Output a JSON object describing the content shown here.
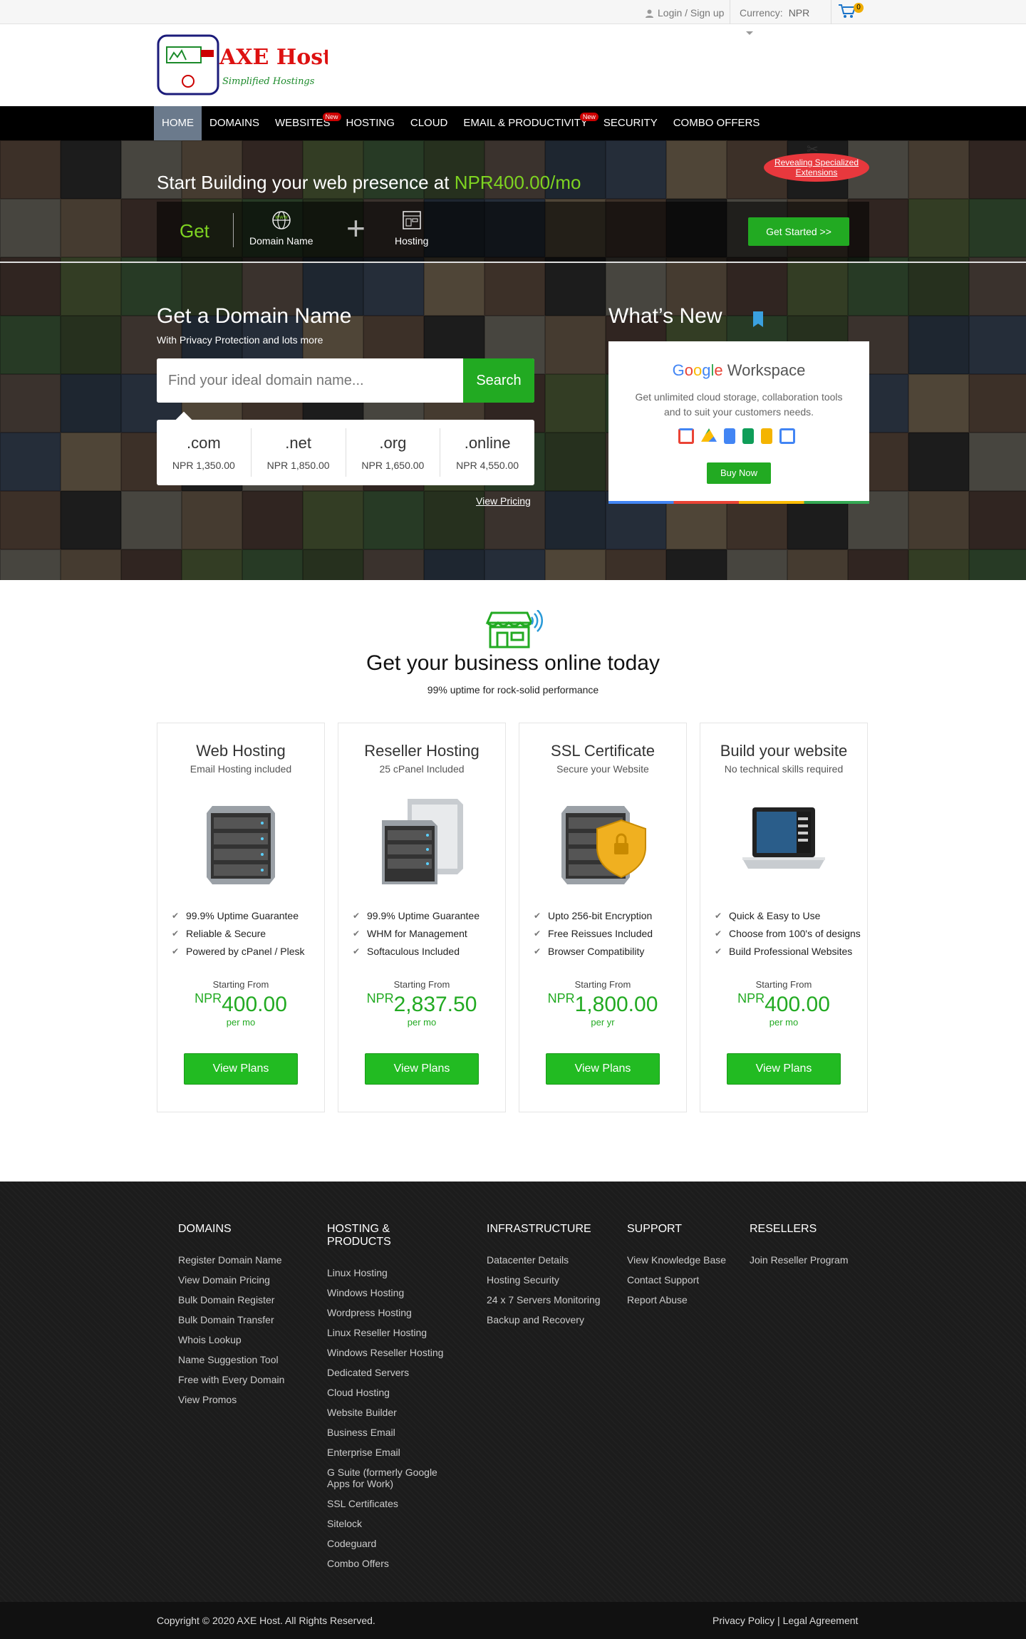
{
  "topbar": {
    "login": "Login / Sign up",
    "currency_label": "Currency:",
    "currency_value": "NPR",
    "cart_count": "0"
  },
  "logo": {
    "name": "AXE Host",
    "tagline": "Simplified Hostings"
  },
  "nav": {
    "items": [
      {
        "label": "HOME",
        "active": true
      },
      {
        "label": "DOMAINS"
      },
      {
        "label": "WEBSITES",
        "badge": "New"
      },
      {
        "label": "HOSTING"
      },
      {
        "label": "CLOUD"
      },
      {
        "label": "EMAIL & PRODUCTIVITY",
        "badge": "New"
      },
      {
        "label": "SECURITY"
      },
      {
        "label": "COMBO OFFERS"
      }
    ]
  },
  "hero": {
    "promo_prefix": "Start Building your web presence at",
    "promo_price": "NPR400.00/mo",
    "ribbon": "Revealing Specialized Extensions",
    "get": "Get",
    "item1": "Domain Name",
    "item2": "Hosting",
    "cta": "Get Started >>"
  },
  "domain": {
    "title": "Get a Domain Name",
    "subtitle": "With Privacy Protection and lots more",
    "placeholder": "Find your ideal domain name...",
    "search_button": "Search",
    "tlds": [
      {
        "ext": ".com",
        "price": "NPR 1,350.00"
      },
      {
        "ext": ".net",
        "price": "NPR 1,850.00"
      },
      {
        "ext": ".org",
        "price": "NPR 1,650.00"
      },
      {
        "ext": ".online",
        "price": "NPR 4,550.00"
      }
    ],
    "view_pricing": "View Pricing"
  },
  "whats_new": {
    "title": "What’s New",
    "brand_g": "G",
    "brand_o1": "o",
    "brand_o2": "o",
    "brand_g2": "g",
    "brand_l": "l",
    "brand_e": "e",
    "brand_rest": " Workspace",
    "desc": "Get unlimited cloud storage, collaboration tools and to suit your customers needs.",
    "button": "Buy Now"
  },
  "business": {
    "title": "Get your business online today",
    "subtitle": "99% uptime for rock-solid performance",
    "cards": [
      {
        "title": "Web Hosting",
        "sub": "Email Hosting included",
        "features": [
          "99.9% Uptime Guarantee",
          "Reliable & Secure",
          "Powered by cPanel / Plesk"
        ],
        "starting": "Starting From",
        "cur": "NPR",
        "amount": "400.00",
        "per": "per mo",
        "button": "View Plans"
      },
      {
        "title": "Reseller Hosting",
        "sub": "25 cPanel Included",
        "features": [
          "99.9% Uptime Guarantee",
          "WHM for Management",
          "Softaculous Included"
        ],
        "starting": "Starting From",
        "cur": "NPR",
        "amount": "2,837.50",
        "per": "per mo",
        "button": "View Plans"
      },
      {
        "title": "SSL Certificate",
        "sub": "Secure your Website",
        "features": [
          "Upto 256-bit Encryption",
          "Free Reissues Included",
          "Browser Compatibility"
        ],
        "starting": "Starting From",
        "cur": "NPR",
        "amount": "1,800.00",
        "per": "per yr",
        "button": "View Plans"
      },
      {
        "title": "Build your website",
        "sub": "No technical skills required",
        "features": [
          "Quick & Easy to Use",
          "Choose from 100's of designs",
          "Build Professional Websites"
        ],
        "starting": "Starting From",
        "cur": "NPR",
        "amount": "400.00",
        "per": "per mo",
        "button": "View Plans"
      }
    ]
  },
  "footer": {
    "cols": [
      {
        "title": "DOMAINS",
        "links": [
          "Register Domain Name",
          "View Domain Pricing",
          "Bulk Domain Register",
          "Bulk Domain Transfer",
          "Whois Lookup",
          "Name Suggestion Tool",
          "Free with Every Domain",
          "View Promos"
        ]
      },
      {
        "title": "HOSTING & PRODUCTS",
        "links": [
          "Linux Hosting",
          "Windows Hosting",
          "Wordpress Hosting",
          "Linux Reseller Hosting",
          "Windows Reseller Hosting",
          "Dedicated Servers",
          "Cloud Hosting",
          "Website Builder",
          "Business Email",
          "Enterprise Email",
          "G Suite (formerly Google Apps for Work)",
          "SSL Certificates",
          "Sitelock",
          "Codeguard",
          "Combo Offers"
        ]
      },
      {
        "title": "INFRASTRUCTURE",
        "links": [
          "Datacenter Details",
          "Hosting Security",
          "24 x 7 Servers Monitoring",
          "Backup and Recovery"
        ]
      },
      {
        "title": "SUPPORT",
        "links": [
          "View Knowledge Base",
          "Contact Support",
          "Report Abuse"
        ]
      },
      {
        "title": "RESELLERS",
        "links": [
          "Join Reseller Program"
        ]
      }
    ],
    "copyright": "Copyright © 2020 AXE Host. All Rights Reserved.",
    "privacy": "Privacy Policy",
    "divider": "|",
    "legal": "Legal Agreement"
  },
  "colors": {
    "accent_green": "#22aa22",
    "promo_green": "#7ed321",
    "nav_bg": "#000000",
    "footer_bg": "#1c1c1c"
  }
}
